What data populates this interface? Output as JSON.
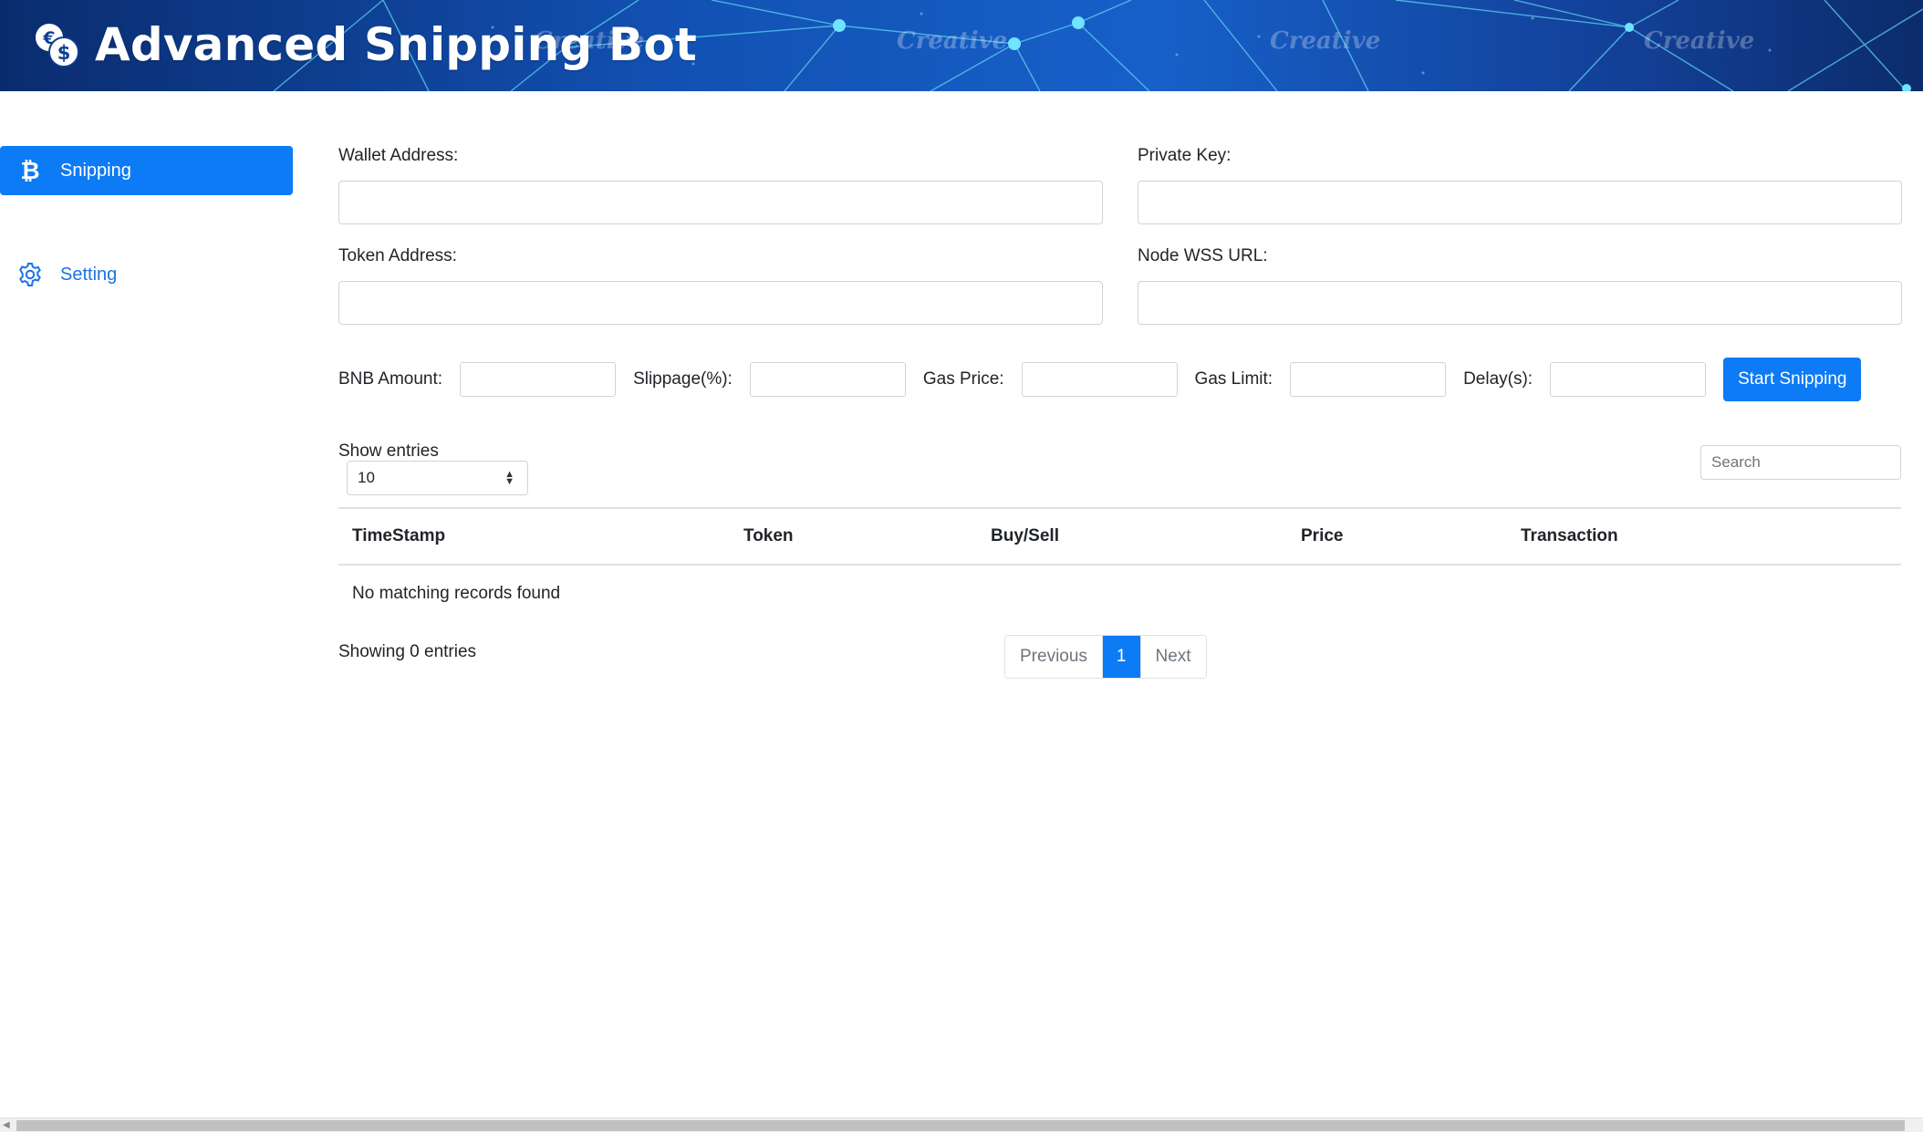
{
  "header": {
    "title": "Advanced Snipping Bot",
    "logo_icon": "currency-exchange-icon",
    "watermark": "Creative"
  },
  "sidebar": {
    "items": [
      {
        "label": "Snipping",
        "icon": "bitcoin-icon",
        "active": true
      },
      {
        "label": "Setting",
        "icon": "gear-icon",
        "active": false
      }
    ]
  },
  "form": {
    "wallet_address": {
      "label": "Wallet Address:",
      "value": ""
    },
    "private_key": {
      "label": "Private Key:",
      "value": ""
    },
    "token_address": {
      "label": "Token Address:",
      "value": ""
    },
    "node_wss_url": {
      "label": "Node WSS URL:",
      "value": ""
    }
  },
  "params": {
    "bnb_amount": {
      "label": "BNB Amount:",
      "value": ""
    },
    "slippage": {
      "label": "Slippage(%):",
      "value": ""
    },
    "gas_price": {
      "label": "Gas Price:",
      "value": ""
    },
    "gas_limit": {
      "label": "Gas Limit:",
      "value": ""
    },
    "delay": {
      "label": "Delay(s):",
      "value": ""
    },
    "start_button": "Start Snipping"
  },
  "table_controls": {
    "show_entries_label": "Show entries",
    "entries_value": "10",
    "search_placeholder": "Search"
  },
  "table": {
    "columns": [
      "TimeStamp",
      "Token",
      "Buy/Sell",
      "Price",
      "Transaction"
    ],
    "empty_message": "No matching records found"
  },
  "footer": {
    "showing": "Showing 0 entries",
    "pagination": {
      "previous": "Previous",
      "current": "1",
      "next": "Next"
    }
  },
  "colors": {
    "accent": "#0d7bf5",
    "link": "#1a73e8",
    "header_bg": "#1251b3"
  }
}
